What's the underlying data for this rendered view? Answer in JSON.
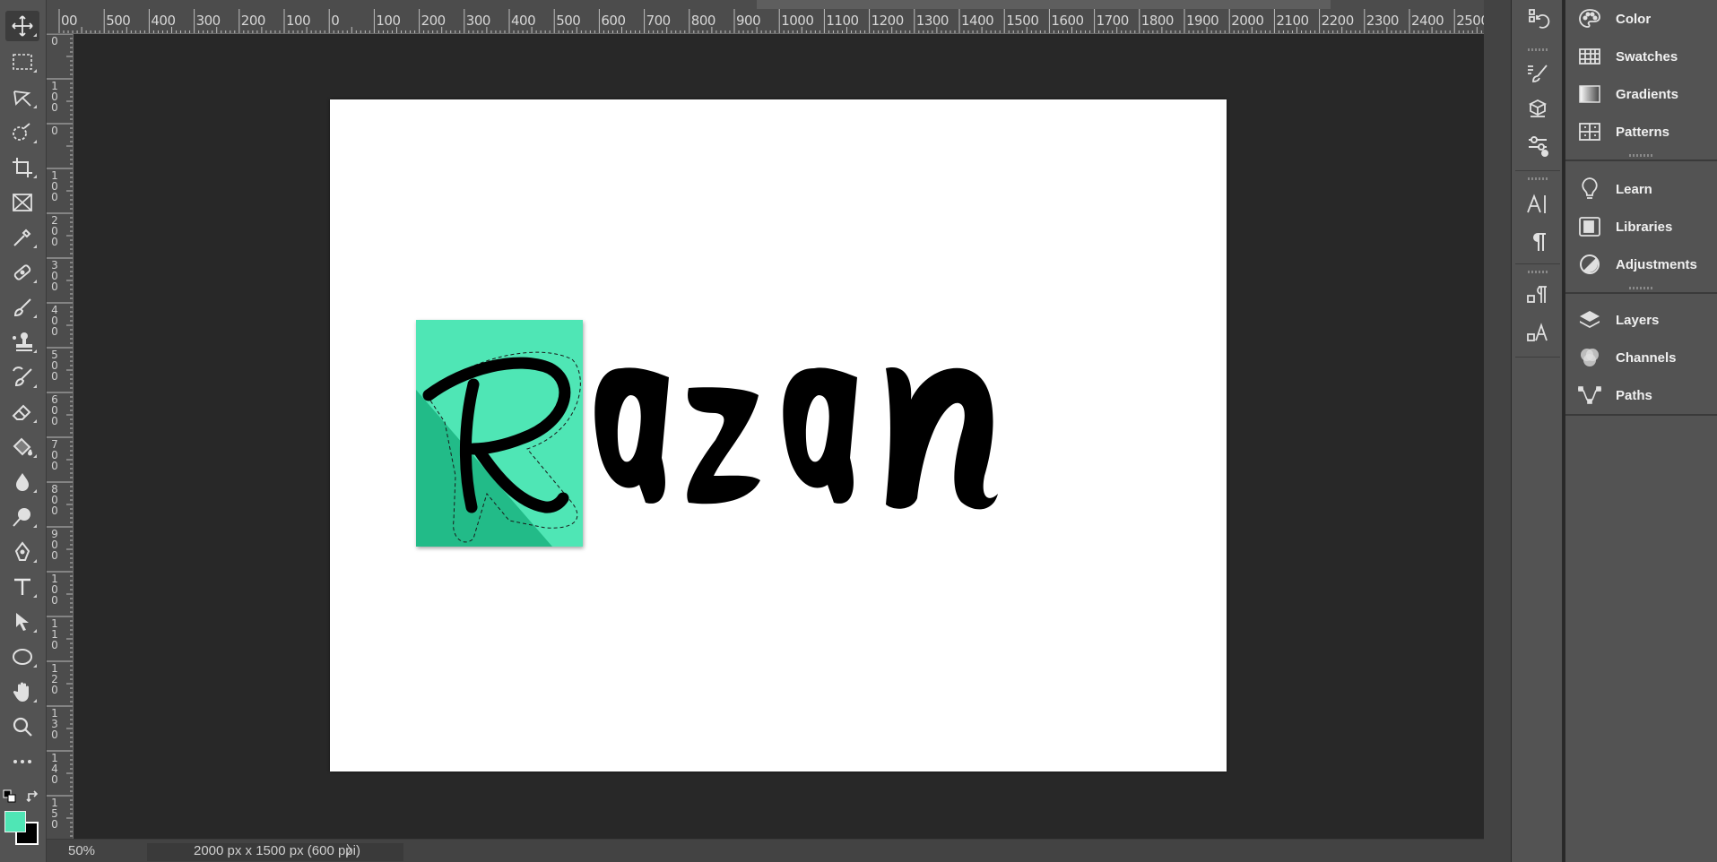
{
  "document": {
    "zoom": "50%",
    "info": "2000 px x 1500 px (600 ppi)",
    "logo_text": "Razan",
    "foreground_color": "#4fe6b5",
    "background_color": "#000000",
    "logo_tile_light": "#4fe6b5",
    "logo_tile_dark": "#20bb88"
  },
  "ruler": {
    "top_labels": [
      "00",
      "500",
      "400",
      "300",
      "200",
      "100",
      "0",
      "100",
      "200",
      "300",
      "400",
      "500",
      "600",
      "700",
      "800",
      "900",
      "1000",
      "1100",
      "1200",
      "1300",
      "1400",
      "1500",
      "1600",
      "1700",
      "1800",
      "1900",
      "2000",
      "2100",
      "2200",
      "2300",
      "2400",
      "2500"
    ],
    "left_labels": [
      "0",
      "1 0 0",
      "0",
      "1 0 0",
      "2 0 0",
      "3 0 0",
      "4 0 0",
      "5 0 0",
      "6 0 0",
      "7 0 0",
      "8 0 0",
      "9 0 0",
      "1 0 0",
      "1 1 0",
      "1 2 0",
      "1 3 0",
      "1 4 0",
      "1 5 0"
    ]
  },
  "tools": [
    {
      "name": "move-tool",
      "icon": "move-icon"
    },
    {
      "name": "marquee-tool",
      "icon": "rect-marquee-icon"
    },
    {
      "name": "lasso-tool",
      "icon": "lasso-icon"
    },
    {
      "name": "quick-select-tool",
      "icon": "quick-select-icon"
    },
    {
      "name": "crop-tool",
      "icon": "crop-icon"
    },
    {
      "name": "frame-tool",
      "icon": "frame-icon"
    },
    {
      "name": "eyedropper-tool",
      "icon": "eyedropper-icon"
    },
    {
      "name": "healing-brush-tool",
      "icon": "bandage-icon"
    },
    {
      "name": "brush-tool",
      "icon": "brush-icon"
    },
    {
      "name": "clone-stamp-tool",
      "icon": "stamp-icon"
    },
    {
      "name": "history-brush-tool",
      "icon": "history-brush-icon"
    },
    {
      "name": "eraser-tool",
      "icon": "eraser-icon"
    },
    {
      "name": "paint-bucket-tool",
      "icon": "bucket-icon"
    },
    {
      "name": "blur-tool",
      "icon": "drop-icon"
    },
    {
      "name": "dodge-tool",
      "icon": "dodge-icon"
    },
    {
      "name": "pen-tool",
      "icon": "pen-icon"
    },
    {
      "name": "type-tool",
      "icon": "type-icon"
    },
    {
      "name": "path-select-tool",
      "icon": "arrow-icon"
    },
    {
      "name": "ellipse-tool",
      "icon": "ellipse-icon"
    },
    {
      "name": "hand-tool",
      "icon": "hand-icon"
    },
    {
      "name": "zoom-tool",
      "icon": "zoom-icon"
    },
    {
      "name": "more-tools",
      "icon": "ellipsis-icon"
    }
  ],
  "panels": {
    "group1": [
      {
        "label": "Color",
        "icon": "palette-icon"
      },
      {
        "label": "Swatches",
        "icon": "grid-icon"
      },
      {
        "label": "Gradients",
        "icon": "gradient-icon"
      },
      {
        "label": "Patterns",
        "icon": "pattern-icon"
      }
    ],
    "group2": [
      {
        "label": "Learn",
        "icon": "lightbulb-icon"
      },
      {
        "label": "Libraries",
        "icon": "libraries-icon"
      },
      {
        "label": "Adjustments",
        "icon": "adjustments-icon"
      }
    ],
    "group3": [
      {
        "label": "Layers",
        "icon": "layers-icon"
      },
      {
        "label": "Channels",
        "icon": "channels-icon"
      },
      {
        "label": "Paths",
        "icon": "paths-icon"
      }
    ]
  },
  "strip_icons": [
    "history-icon",
    "brush-presets-icon",
    "3d-icon",
    "properties-icon",
    "character-icon",
    "paragraph-icon",
    "paragraph-styles-icon",
    "character-styles-icon"
  ]
}
